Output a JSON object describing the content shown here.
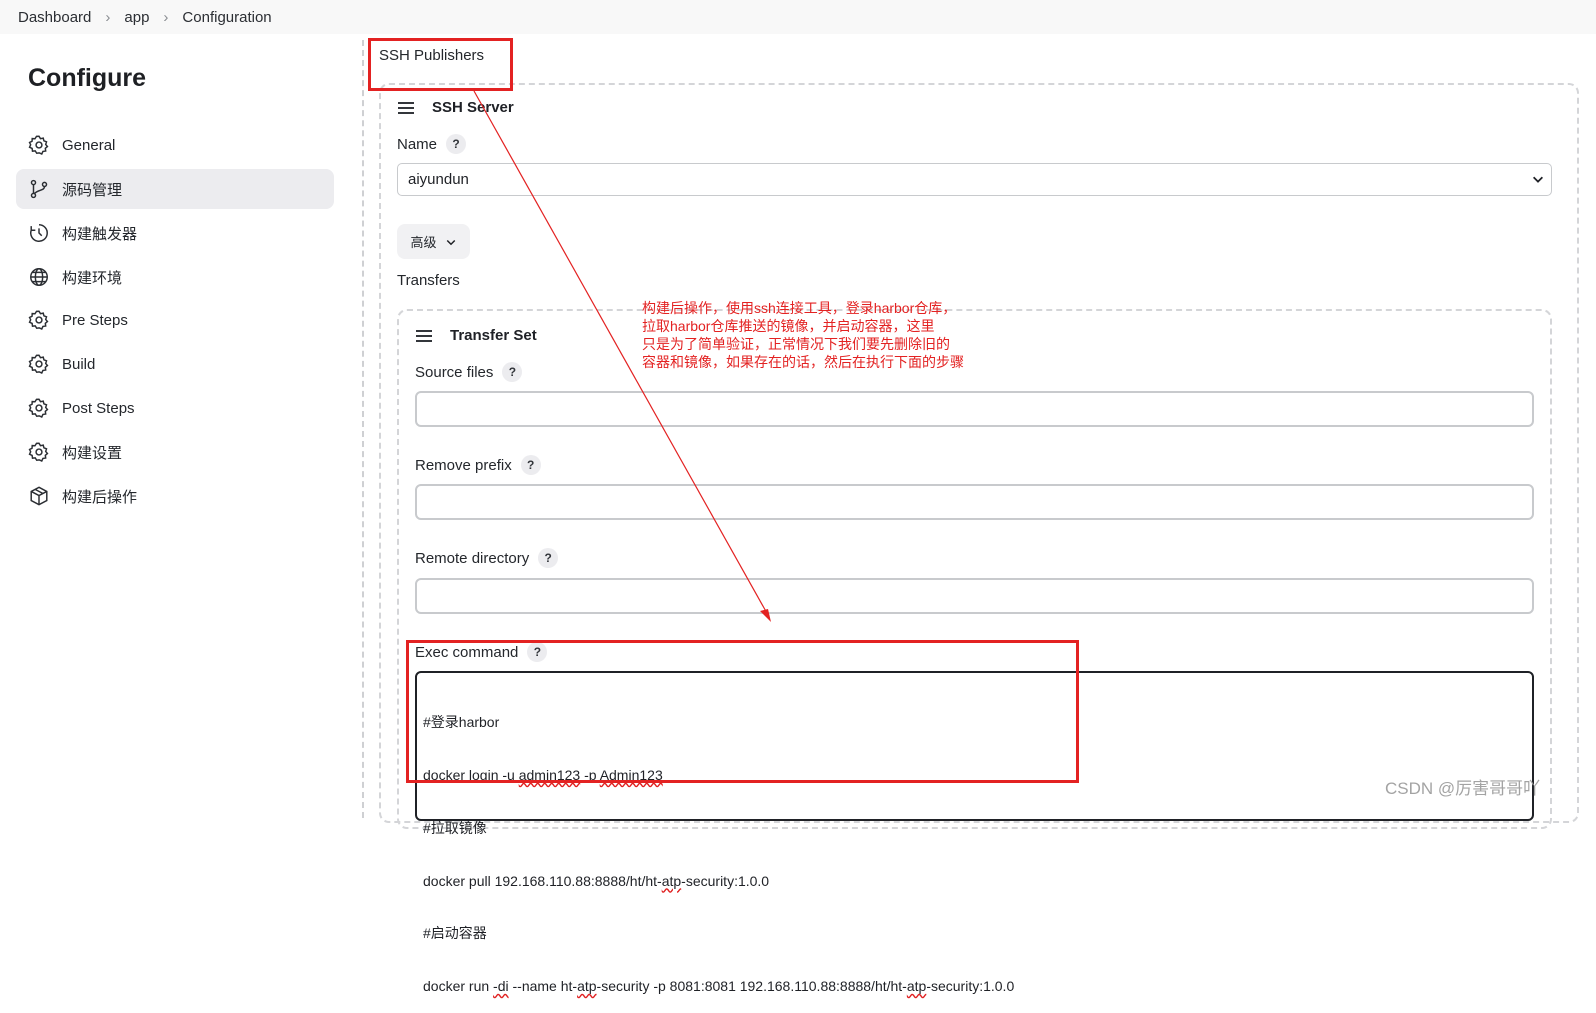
{
  "breadcrumb": [
    "Dashboard",
    "app",
    "Configuration"
  ],
  "sidebar": {
    "title": "Configure",
    "items": [
      {
        "label": "General",
        "icon": "gear-icon",
        "active": false
      },
      {
        "label": "源码管理",
        "icon": "git-branch-icon",
        "active": true
      },
      {
        "label": "构建触发器",
        "icon": "clock-icon",
        "active": false
      },
      {
        "label": "构建环境",
        "icon": "globe-icon",
        "active": false
      },
      {
        "label": "Pre Steps",
        "icon": "gear-icon",
        "active": false
      },
      {
        "label": "Build",
        "icon": "gear-icon",
        "active": false
      },
      {
        "label": "Post Steps",
        "icon": "gear-icon",
        "active": false
      },
      {
        "label": "构建设置",
        "icon": "gear-icon",
        "active": false
      },
      {
        "label": "构建后操作",
        "icon": "package-icon",
        "active": false
      }
    ]
  },
  "main": {
    "section_label": "SSH Publishers",
    "ssh_server": {
      "title": "SSH Server",
      "name_label": "Name",
      "help_glyph": "?",
      "name_value": "aiyundun",
      "advanced_label": "高级",
      "transfers_label": "Transfers"
    },
    "transfer_set": {
      "title": "Transfer Set",
      "source_files_label": "Source files",
      "remove_prefix_label": "Remove prefix",
      "remote_directory_label": "Remote directory",
      "exec_command_label": "Exec command",
      "exec_command_lines": [
        "#登录harbor",
        "docker login -u admin123 -p Admin123",
        "#拉取镜像",
        "docker pull 192.168.110.88:8888/ht/ht-atp-security:1.0.0",
        "#启动容器",
        "docker run -di --name ht-atp-security -p 8081:8081 192.168.110.88:8888/ht/ht-atp-security:1.0.0"
      ]
    }
  },
  "annotation": {
    "note_lines": [
      "构建后操作，使用ssh连接工具，登录harbor仓库，",
      "拉取harbor仓库推送的镜像，并启动容器，这里",
      "只是为了简单验证，正常情况下我们要先删除旧的",
      "容器和镜像，如果存在的话，然后在执行下面的步骤"
    ],
    "color": "#e32222"
  },
  "watermark": "CSDN @厉害哥哥吖"
}
